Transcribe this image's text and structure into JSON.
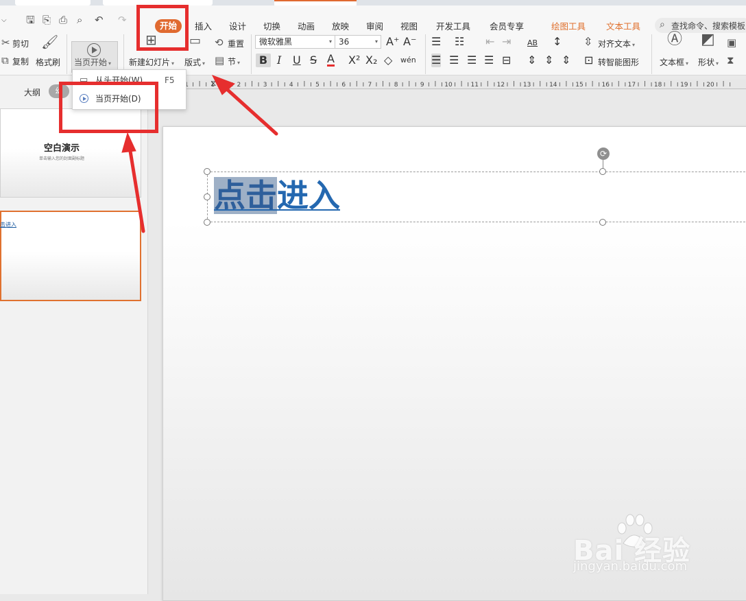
{
  "menu": {
    "tabs": [
      "开始",
      "插入",
      "设计",
      "切换",
      "动画",
      "放映",
      "审阅",
      "视图",
      "开发工具",
      "会员专享",
      "绘图工具",
      "文本工具"
    ],
    "search_placeholder": "查找命令、搜索模板"
  },
  "ribbon": {
    "cut": "剪切",
    "copy": "复制",
    "format_painter": "格式刷",
    "present_from_current": "当页开始",
    "new_slide": "新建幻灯片",
    "layout": "版式",
    "reset": "重置",
    "section": "节",
    "font_name": "微软雅黑",
    "font_size": "36",
    "align_text": "对齐文本",
    "smartart": "转智能图形",
    "textbox": "文本框",
    "shape": "形状"
  },
  "dropdown": {
    "items": [
      {
        "label": "从头开始(W)",
        "shortcut": "F5"
      },
      {
        "label": "当页开始(D)",
        "shortcut": ""
      }
    ]
  },
  "left_panel": {
    "outline_tab": "大纲",
    "slides_tab": "幻",
    "thumb1_title": "空白演示",
    "thumb1_subtitle": "单击输入您的封面副标题",
    "thumb2_text": "击进入"
  },
  "slide": {
    "title_selected": "点击",
    "title_rest": "进入"
  },
  "ruler": {
    "numbers": [
      "1",
      "1",
      "2",
      "3",
      "4",
      "5",
      "6",
      "7",
      "8",
      "9",
      "10",
      "11",
      "12",
      "13",
      "14",
      "15",
      "16",
      "17",
      "18",
      "19",
      "20"
    ]
  },
  "watermark": {
    "logo": "Bai  经验",
    "url": "jingyan.baidu.com"
  },
  "colors": {
    "accent": "#e06a30",
    "annotation": "#e62e2e",
    "title_blue": "#2468b0"
  }
}
